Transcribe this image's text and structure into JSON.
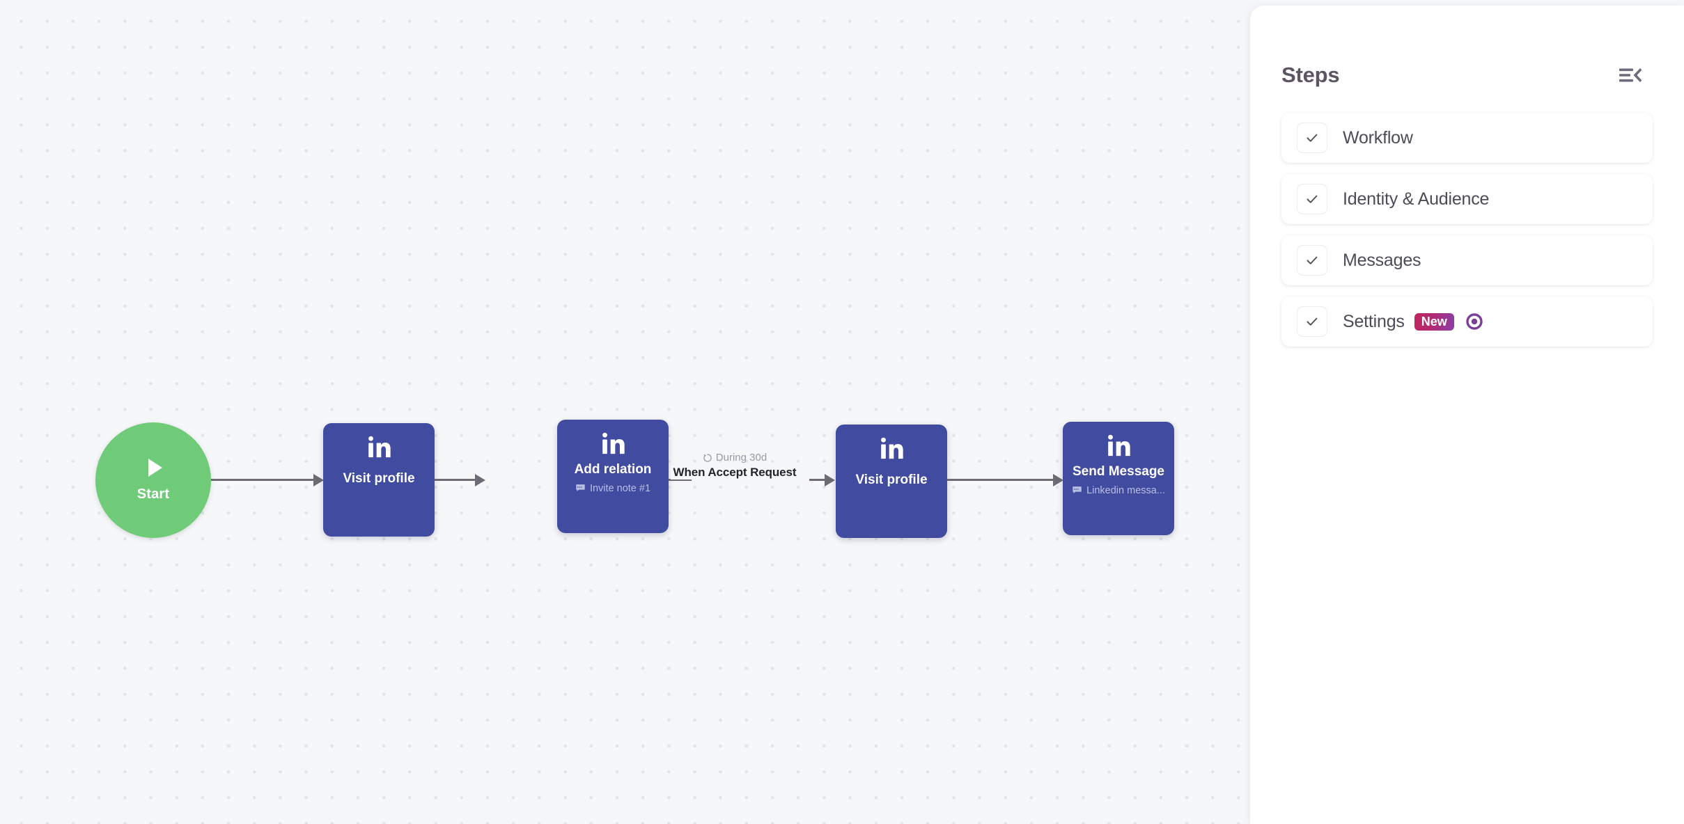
{
  "canvas": {
    "start_node": {
      "label": "Start",
      "icon": "play-icon",
      "color": "#6fcb77"
    },
    "nodes": [
      {
        "id": "visit-profile-1",
        "platform_icon": "linkedin-icon",
        "title": "Visit profile",
        "subtitle": "",
        "subtitle_icon": "",
        "color": "#414ba0"
      },
      {
        "id": "add-relation",
        "platform_icon": "linkedin-icon",
        "title": "Add relation",
        "subtitle": "Invite note #1",
        "subtitle_icon": "message-icon",
        "color": "#414ba0"
      },
      {
        "id": "visit-profile-2",
        "platform_icon": "linkedin-icon",
        "title": "Visit profile",
        "subtitle": "",
        "subtitle_icon": "",
        "color": "#414ba0"
      },
      {
        "id": "send-message",
        "platform_icon": "linkedin-icon",
        "title": "Send Message",
        "subtitle": "Linkedin messa...",
        "subtitle_icon": "message-icon",
        "color": "#414ba0"
      }
    ],
    "edge_label": {
      "duration": "During 30d",
      "duration_icon": "refresh-icon",
      "condition": "When Accept Request"
    }
  },
  "panel": {
    "title": "Steps",
    "collapse_icon": "collapse-panel-icon",
    "steps": [
      {
        "label": "Workflow",
        "checked": true,
        "badge": "",
        "trailing_icon": ""
      },
      {
        "label": "Identity & Audience",
        "checked": true,
        "badge": "",
        "trailing_icon": ""
      },
      {
        "label": "Messages",
        "checked": true,
        "badge": "",
        "trailing_icon": ""
      },
      {
        "label": "Settings",
        "checked": true,
        "badge": "New",
        "trailing_icon": "target-icon"
      }
    ]
  },
  "colors": {
    "node_indigo": "#414ba0",
    "start_green": "#6fcb77",
    "edge_gray": "#6f6b74",
    "badge_gradient_start": "#c2255c",
    "badge_gradient_end": "#8b3fa8",
    "target_purple": "#7b3f98",
    "canvas_bg": "#f6f7f9"
  }
}
